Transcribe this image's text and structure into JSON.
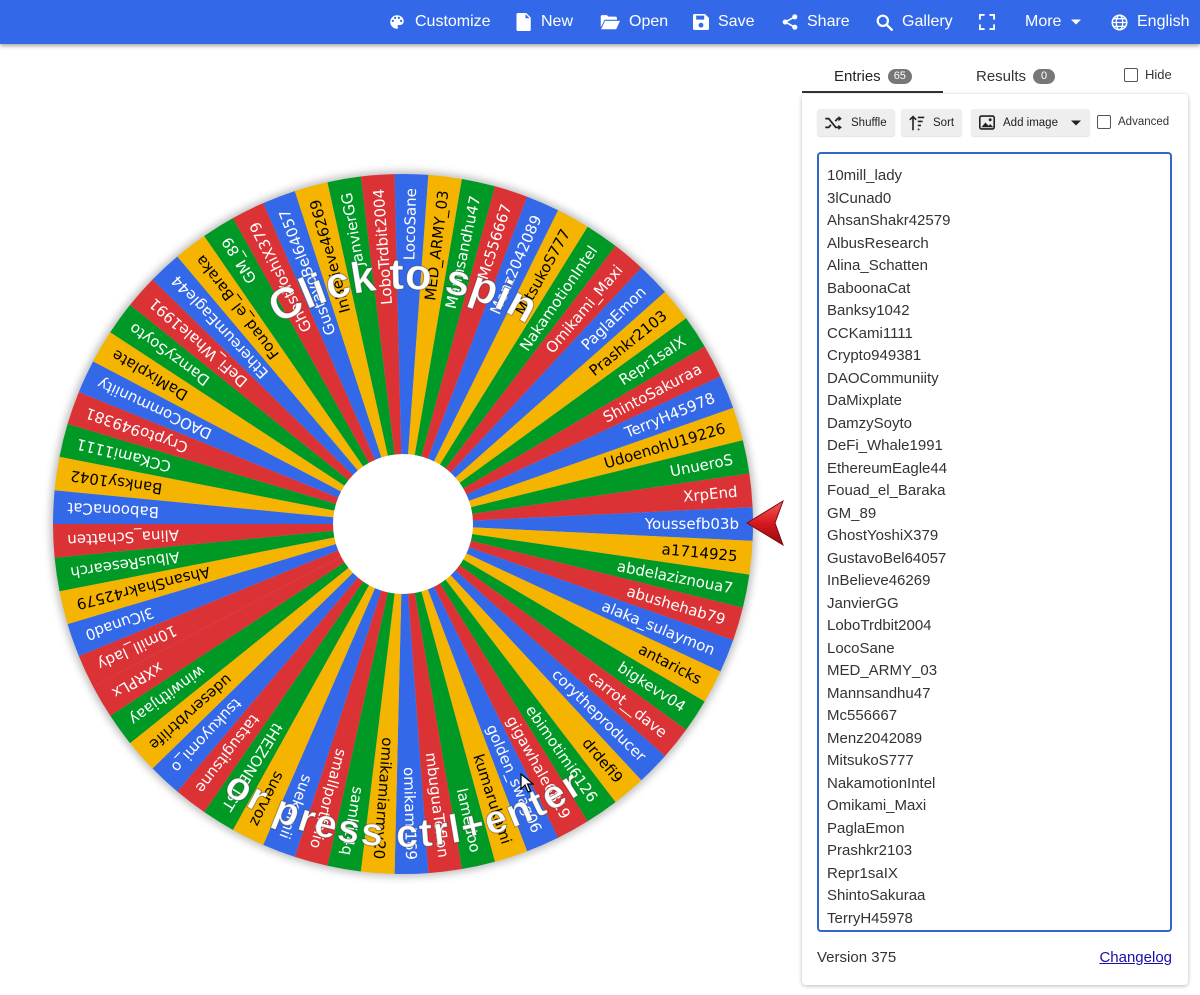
{
  "nav": {
    "items": [
      {
        "key": "customize",
        "label": "Customize",
        "icon": "palette-icon"
      },
      {
        "key": "new",
        "label": "New",
        "icon": "file-icon"
      },
      {
        "key": "open",
        "label": "Open",
        "icon": "folder-open-icon"
      },
      {
        "key": "save",
        "label": "Save",
        "icon": "floppy-disk-icon"
      },
      {
        "key": "share",
        "label": "Share",
        "icon": "share-icon"
      },
      {
        "key": "gallery",
        "label": "Gallery",
        "icon": "search-icon"
      },
      {
        "key": "fullscreen",
        "label": "",
        "icon": "fullscreen-icon"
      },
      {
        "key": "more",
        "label": "More",
        "icon": "chevron-down-icon"
      },
      {
        "key": "language",
        "label": "English",
        "icon": "globe-icon"
      }
    ]
  },
  "wheel": {
    "spin_text_top": "Click to spin",
    "spin_text_bottom": "or press ctrl+enter",
    "segment_colors": [
      "#db3236",
      "#3369e8",
      "#f4b400",
      "#009925"
    ],
    "segments": [
      "10mill_lady",
      "3lCunad0",
      "AhsanShakr42579",
      "AlbusResearch",
      "Alina_Schatten",
      "BaboonaCat",
      "Banksy1042",
      "CCKami1111",
      "Crypto949381",
      "DAOCommuniity",
      "DaMixplate",
      "DamzySoyto",
      "DeFi_Whale1991",
      "EthereumEagle44",
      "Fouad_el_Baraka",
      "GM_89",
      "GhostYoshiX379",
      "GustavoBel64057",
      "InBelieve46269",
      "JanvierGG",
      "LoboTrdbit2004",
      "LocoSane",
      "MED_ARMY_03",
      "Mannsandhu47",
      "Mc556667",
      "Menz2042089",
      "MitsukoS777",
      "NakamotionIntel",
      "Omikami_Maxi",
      "PaglaEmon",
      "Prashkr2103",
      "Repr1saIX",
      "ShintoSakuraa",
      "TerryH45978",
      "UdoenohU19226",
      "UnueroS",
      "XrpEnd",
      "Youssefb03b",
      "a1714925",
      "abdelaziznoua7",
      "abushehab79",
      "alaka_sulaymon",
      "antaricks",
      "bigkevv04",
      "carrot__dave",
      "corytheproducer",
      "drdefi9",
      "ebimotimi6126",
      "gigawhale6819",
      "golden_swag06",
      "kumarukami",
      "lamedoo",
      "mbuguaTeflon",
      "omikami169",
      "omikamiarmy20",
      "samkit4q",
      "smallportfolio",
      "suekamii",
      "suervoz",
      "tHEZONE_IST",
      "tatsugitsune",
      "tsukuyomi_o",
      "udeservbtrlife",
      "winwithjaay",
      "xXRPLx"
    ]
  },
  "panel": {
    "tabs": {
      "entries_label": "Entries",
      "entries_count": "65",
      "results_label": "Results",
      "results_count": "0",
      "hide_label": "Hide"
    },
    "toolbar": {
      "shuffle_label": "Shuffle",
      "sort_label": "Sort",
      "add_image_label": "Add image",
      "advanced_label": "Advanced"
    },
    "entries_visible": [
      "10mill_lady",
      "3lCunad0",
      "AhsanShakr42579",
      "AlbusResearch",
      "Alina_Schatten",
      "BaboonaCat",
      "Banksy1042",
      "CCKami1111",
      "Crypto949381",
      "DAOCommuniity",
      "DaMixplate",
      "DamzySoyto",
      "DeFi_Whale1991",
      "EthereumEagle44",
      "Fouad_el_Baraka",
      "GM_89",
      "GhostYoshiX379",
      "GustavoBel64057",
      "InBelieve46269",
      "JanvierGG",
      "LoboTrdbit2004",
      "LocoSane",
      "MED_ARMY_03",
      "Mannsandhu47",
      "Mc556667",
      "Menz2042089",
      "MitsukoS777",
      "NakamotionIntel",
      "Omikami_Maxi",
      "PaglaEmon",
      "Prashkr2103",
      "Repr1saIX",
      "ShintoSakuraa",
      "TerryH45978"
    ],
    "version": "Version 375",
    "changelog_label": "Changelog"
  },
  "colors": {
    "topbar": "#3369e8",
    "focus_border": "#3465c8",
    "pointer": "#d8181e"
  }
}
